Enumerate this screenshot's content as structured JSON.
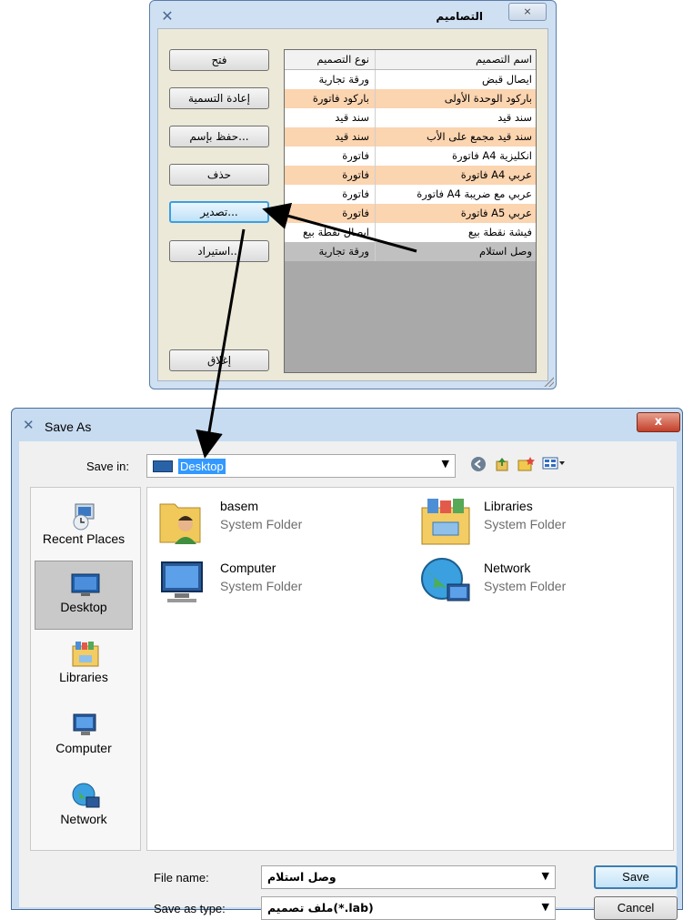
{
  "designs_dialog": {
    "title": "التصاميم",
    "close_glyph": "⨯",
    "buttons": {
      "open": "فتح",
      "rename": "إعادة التسمية",
      "save_as": "حفظ بإسم...",
      "delete": "حذف",
      "export": "تصدير...",
      "import": "استيراد...",
      "close": "إغلاق"
    },
    "table": {
      "columns": [
        "اسم التصميم",
        "نوع التصميم"
      ],
      "rows": [
        {
          "name": "ايصال قبض",
          "type": "ورقة تجارية"
        },
        {
          "name": "باركود الوحدة الأولى",
          "type": "باركود فاتورة"
        },
        {
          "name": "سند قيد",
          "type": "سند قيد"
        },
        {
          "name": "سند قيد مجمع على الأب",
          "type": "سند قيد"
        },
        {
          "name": "فاتورة A4 انكليزية",
          "type": "فاتورة"
        },
        {
          "name": "فاتورة A4 عربي",
          "type": "فاتورة"
        },
        {
          "name": "فاتورة A4 عربي مع ضريبة",
          "type": "فاتورة"
        },
        {
          "name": "فاتورة A5 عربي",
          "type": "فاتورة"
        },
        {
          "name": "فيشة نقطة بيع",
          "type": "ايصال نقطة بيع"
        },
        {
          "name": "وصل استلام",
          "type": "ورقة تجارية"
        }
      ],
      "selected_row": 9
    }
  },
  "save_as_dialog": {
    "title": "Save As",
    "close_glyph": "x",
    "save_in_label": "Save in:",
    "save_in_value": "Desktop",
    "places": [
      {
        "label": "Recent Places",
        "icon": "recent-places-icon"
      },
      {
        "label": "Desktop",
        "icon": "desktop-icon",
        "selected": true
      },
      {
        "label": "Libraries",
        "icon": "libraries-icon"
      },
      {
        "label": "Computer",
        "icon": "computer-icon"
      },
      {
        "label": "Network",
        "icon": "network-icon"
      }
    ],
    "items": [
      {
        "name": "basem",
        "type": "System Folder",
        "icon": "user-folder-icon"
      },
      {
        "name": "Libraries",
        "type": "System Folder",
        "icon": "libraries-icon"
      },
      {
        "name": "Computer",
        "type": "System Folder",
        "icon": "computer-icon"
      },
      {
        "name": "Network",
        "type": "System Folder",
        "icon": "network-icon"
      }
    ],
    "file_name_label": "File name:",
    "file_name_value": "وصل استلام",
    "save_type_label": "Save as type:",
    "save_type_value": "ملف تصميم(*.lab)",
    "save_button": "Save",
    "cancel_button": "Cancel"
  },
  "colors": {
    "alt_row": "#fbd4b0",
    "selected_row": "#c0c0c0",
    "selection_highlight": "#3399ff",
    "close_button_red": "#c3402a"
  }
}
